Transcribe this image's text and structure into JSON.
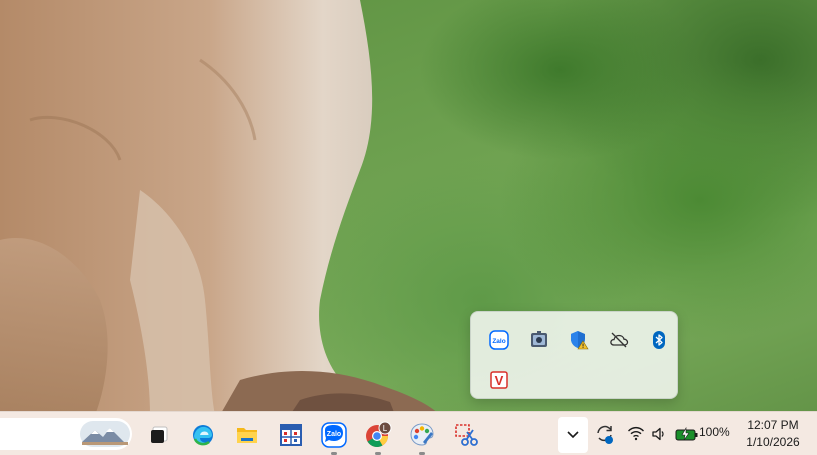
{
  "tray_flyout": {
    "icons": [
      {
        "name": "zalo-tray-icon",
        "label": "Zalo"
      },
      {
        "name": "camera-app-tray-icon"
      },
      {
        "name": "windows-security-warning-icon"
      },
      {
        "name": "onedrive-offline-icon"
      },
      {
        "name": "bluetooth-icon"
      },
      {
        "name": "vcap-red-v-icon",
        "label": "V"
      }
    ]
  },
  "taskbar": {
    "apps": [
      {
        "name": "widgets-weather-thumbnail"
      },
      {
        "name": "task-view-icon"
      },
      {
        "name": "edge-icon"
      },
      {
        "name": "file-explorer-icon"
      },
      {
        "name": "calendar-grid-app-icon"
      },
      {
        "name": "zalo-app-icon",
        "label": "Zalo"
      },
      {
        "name": "chrome-icon",
        "badge": "L"
      },
      {
        "name": "paint-icon"
      },
      {
        "name": "snipping-tool-icon"
      }
    ],
    "battery_percent": "100%",
    "time": "12:07 PM",
    "date": "1/10/2026"
  },
  "colors": {
    "taskbar_bg": "#f4e9e2",
    "accent_blue": "#0067c0",
    "zalo_blue": "#0068ff",
    "battery_green": "#1a8f2a"
  }
}
